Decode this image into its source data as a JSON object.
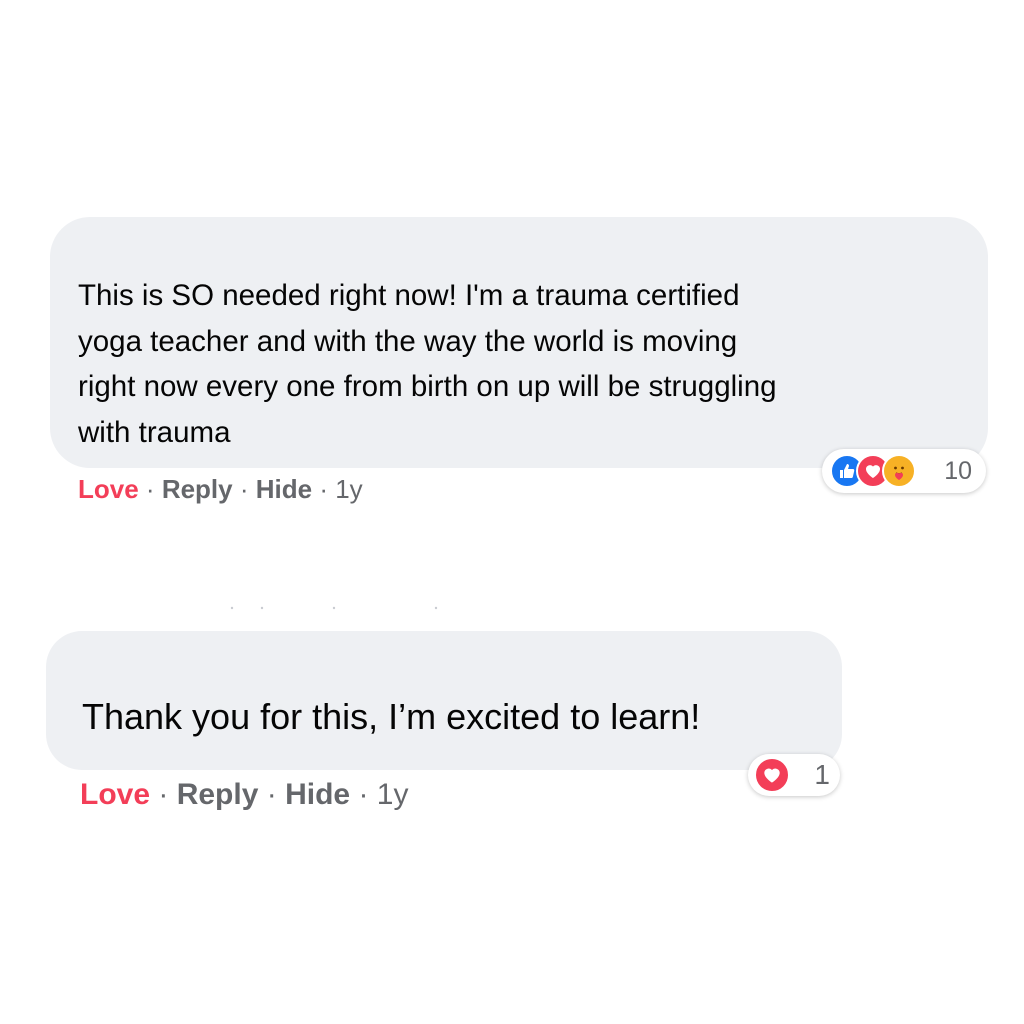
{
  "comments": [
    {
      "text": "This is SO needed right now! I'm a trauma certified\nyoga teacher and with the way the world is moving\nright now every one from birth on up will be struggling\nwith trauma",
      "actions": {
        "love": "Love",
        "reply": "Reply",
        "hide": "Hide",
        "time": "1y",
        "sep": "·"
      },
      "reactions": {
        "icons": [
          "like-icon",
          "love-icon",
          "care-icon"
        ],
        "count": "10"
      }
    },
    {
      "text": "Thank you for this, I’m excited to learn!",
      "actions": {
        "love": "Love",
        "reply": "Reply",
        "hide": "Hide",
        "time": "1y",
        "sep": "·"
      },
      "reactions": {
        "icons": [
          "love-icon"
        ],
        "count": "1"
      }
    }
  ],
  "colors": {
    "bubble": "#eef0f3",
    "love": "#f33e58",
    "meta": "#65676b",
    "like": "#1877f2",
    "care": "#f7b125"
  }
}
